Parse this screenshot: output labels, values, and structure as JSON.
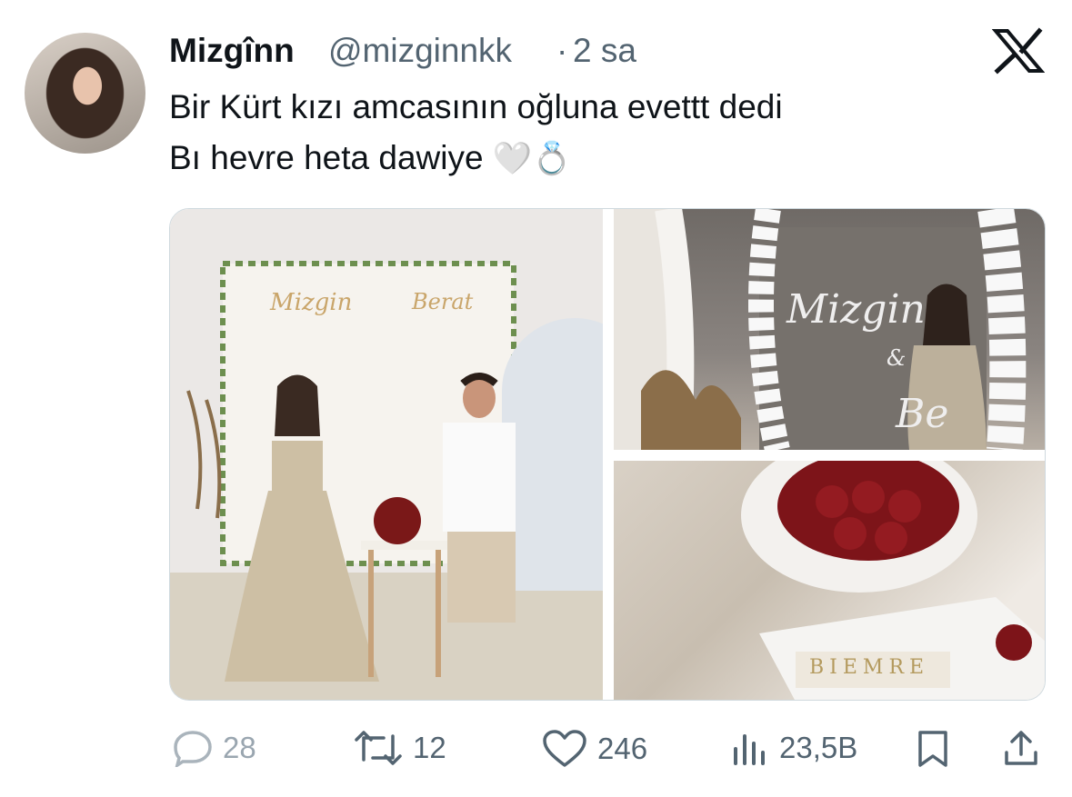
{
  "tweet": {
    "display_name": "Mizgînn",
    "handle": "@mizginnkk",
    "separator": "·",
    "time_ago": "2 sa",
    "text_line1": "Bir Kürt kızı amcasının oğluna evettt dedi",
    "text_line2": "Bı hevre heta dawiye",
    "emoji1": "🤍",
    "emoji2": "💍"
  },
  "media": {
    "photo1_name_left": "Mizgin",
    "photo1_name_right": "Berat",
    "photo2_name": "Mizgin",
    "photo2_amp": "&",
    "photo2_name2": "Be",
    "photo3_tiles": "BIEMRE"
  },
  "actions": {
    "replies": "28",
    "retweets": "12",
    "likes": "246",
    "views": "23,5B"
  },
  "colors": {
    "text": "#0f1419",
    "secondary": "#536471",
    "border": "#cfd9de"
  }
}
